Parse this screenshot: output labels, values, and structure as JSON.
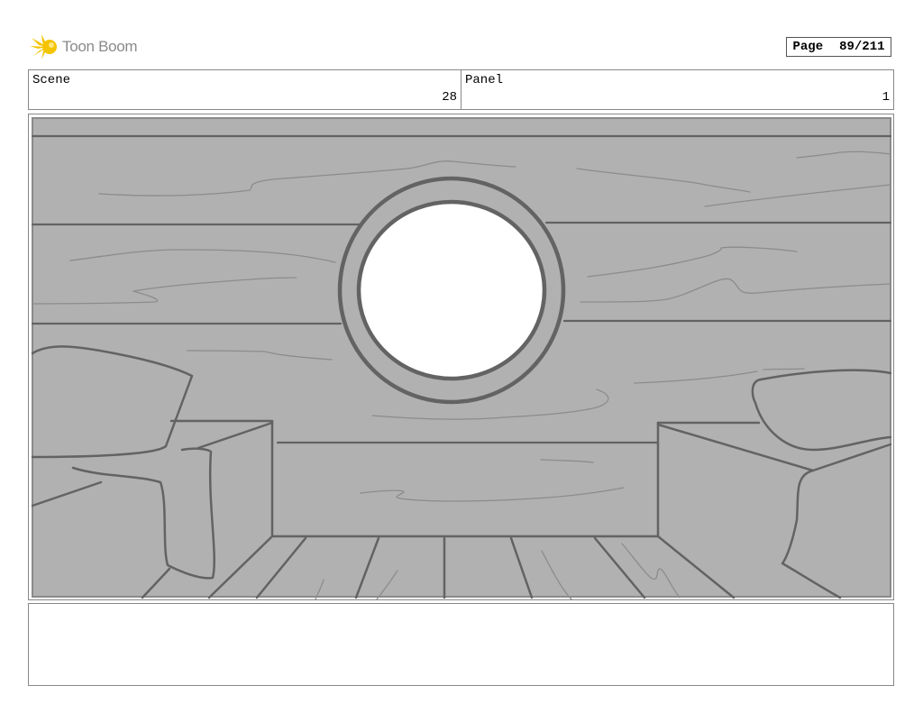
{
  "header": {
    "brand": "Toon Boom",
    "page_label": "Page",
    "page_value": "89/211"
  },
  "fields": {
    "scene_label": "Scene",
    "scene_value": "28",
    "panel_label": "Panel",
    "panel_value": "1"
  },
  "notes": {
    "text": ""
  },
  "colors": {
    "brand_yellow": "#f5c400",
    "sketch_gray": "#b1b1b1",
    "line_dark": "#636363",
    "line_light": "#8c8c8c"
  },
  "icons": {
    "logo": "toon-boom-logo-icon"
  }
}
